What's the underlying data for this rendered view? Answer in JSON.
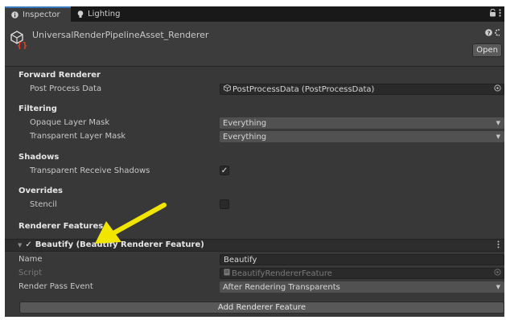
{
  "tabs": [
    {
      "label": "Inspector",
      "icon": "info-icon",
      "active": true
    },
    {
      "label": "Lighting",
      "icon": "lightbulb-icon",
      "active": false
    }
  ],
  "tabbar_actions": [
    "lock-icon",
    "kebab-menu-icon"
  ],
  "asset": {
    "title": "UniversalRenderPipelineAsset_Renderer",
    "icon": "script-asset-icon",
    "open_label": "Open"
  },
  "sections": {
    "forward_renderer": "Forward Renderer",
    "filtering": "Filtering",
    "shadows": "Shadows",
    "overrides": "Overrides",
    "renderer_features": "Renderer Features"
  },
  "fields": {
    "post_process_data": {
      "label": "Post Process Data",
      "value": "PostProcessData (PostProcessData)"
    },
    "opaque_layer_mask": {
      "label": "Opaque Layer Mask",
      "value": "Everything"
    },
    "transparent_layer_mask": {
      "label": "Transparent Layer Mask",
      "value": "Everything"
    },
    "transparent_receive_shadows": {
      "label": "Transparent Receive Shadows",
      "checked": true,
      "check_glyph": "✓"
    },
    "stencil": {
      "label": "Stencil",
      "checked": false
    }
  },
  "feature": {
    "title": "Beautify (Beautify Renderer Feature)",
    "enabled": true,
    "check_glyph": "✓",
    "name_label": "Name",
    "name_value": "Beautify",
    "script_label": "Script",
    "script_value": "BeautifyRendererFeature",
    "render_pass_label": "Render Pass Event",
    "render_pass_value": "After Rendering Transparents"
  },
  "add_feature_label": "Add Renderer Feature",
  "colors": {
    "panel_bg": "#383838",
    "tabbar_bg": "#191919",
    "accent_tab": "#3a79bb",
    "annotation_arrow": "#f2e600"
  }
}
